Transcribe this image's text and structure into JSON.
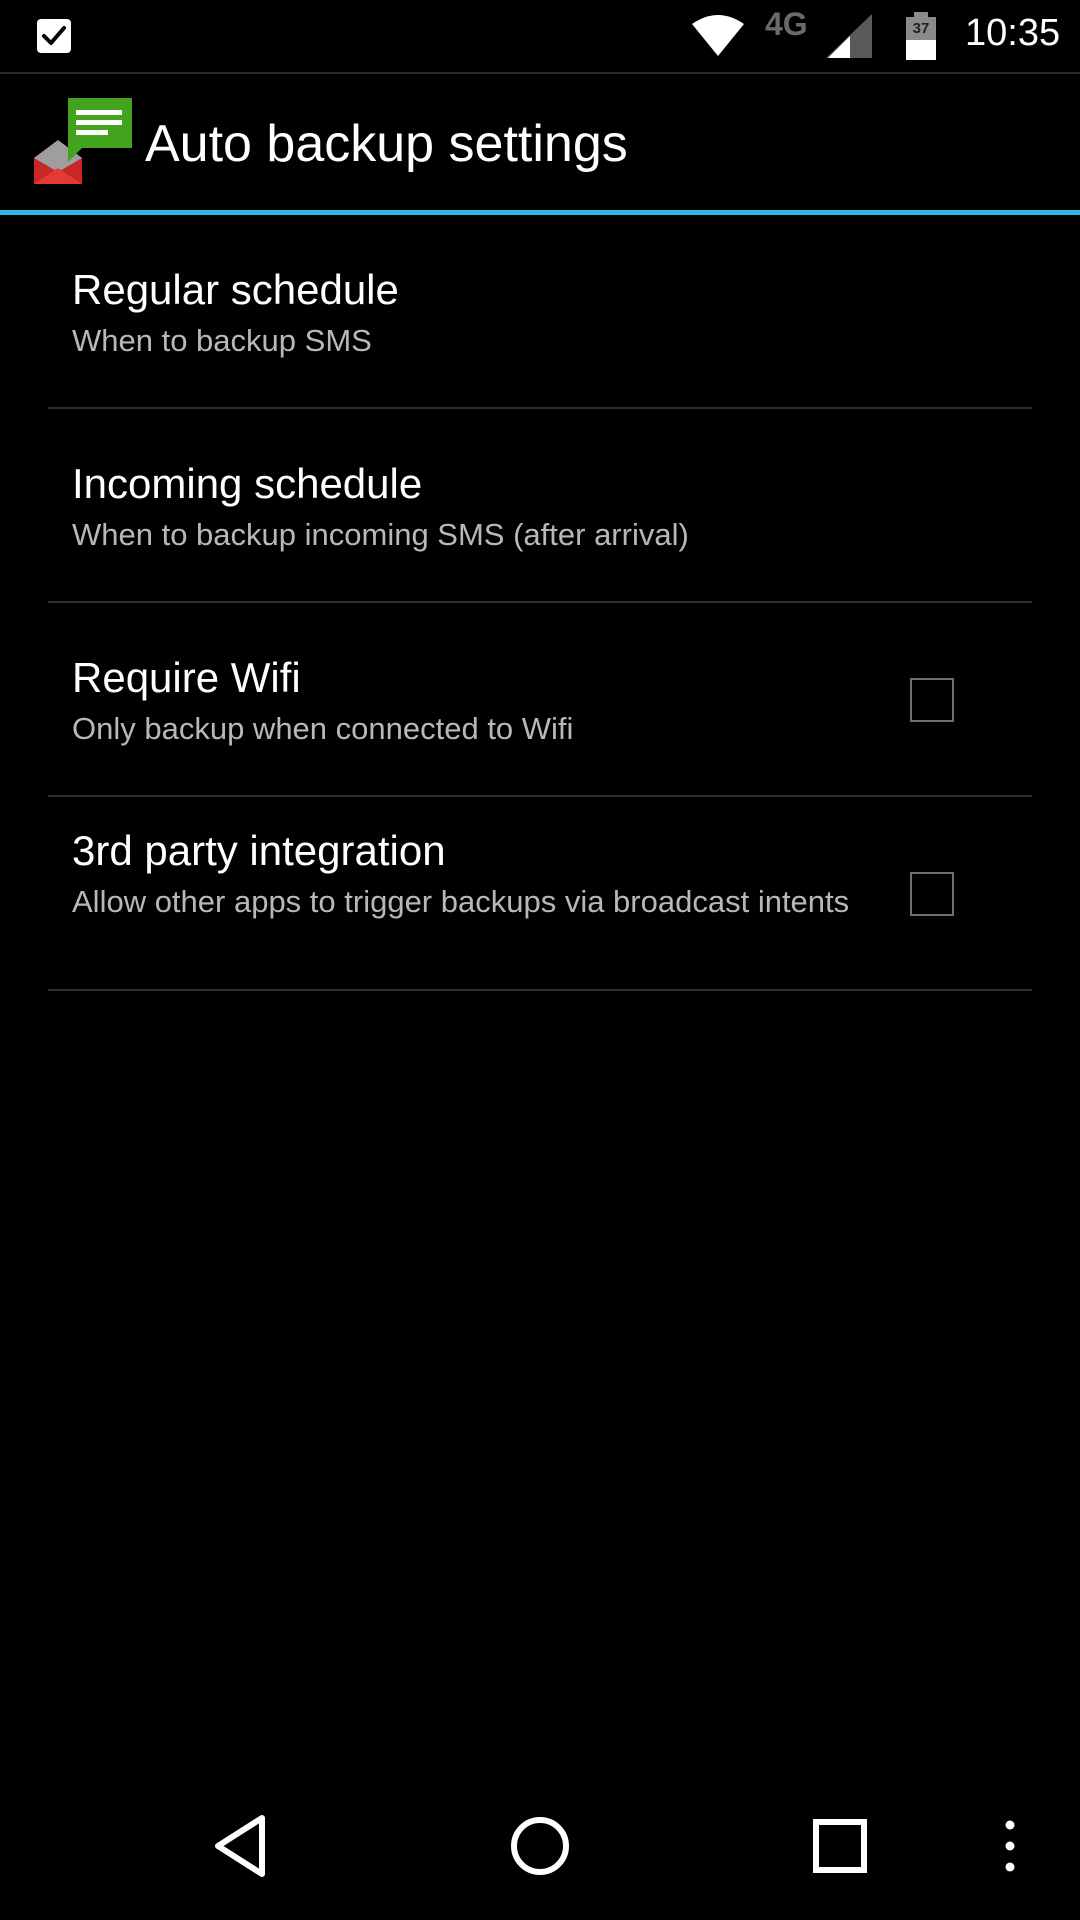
{
  "status_bar": {
    "network_type": "4G",
    "battery_level": "37",
    "time": "10:35",
    "icons": [
      "checkbox-notification-icon",
      "wifi-icon",
      "cell-signal-icon",
      "battery-icon"
    ]
  },
  "action_bar": {
    "title": "Auto backup settings",
    "icon": "sms-backup-app-icon"
  },
  "preferences": [
    {
      "title": "Regular schedule",
      "summary": "When to backup SMS",
      "has_checkbox": false
    },
    {
      "title": "Incoming schedule",
      "summary": "When to backup incoming SMS (after arrival)",
      "has_checkbox": false
    },
    {
      "title": "Require Wifi",
      "summary": "Only backup when connected to Wifi",
      "has_checkbox": true,
      "checked": false
    },
    {
      "title": "3rd party integration",
      "summary": "Allow other apps to trigger backups via broadcast intents",
      "has_checkbox": true,
      "checked": false
    }
  ],
  "nav_bar": {
    "buttons": [
      "back-icon",
      "home-icon",
      "recents-icon",
      "overflow-menu-icon"
    ]
  },
  "colors": {
    "background": "#000000",
    "accent": "#33b5e5",
    "summary_text": "#b8b8b8"
  }
}
